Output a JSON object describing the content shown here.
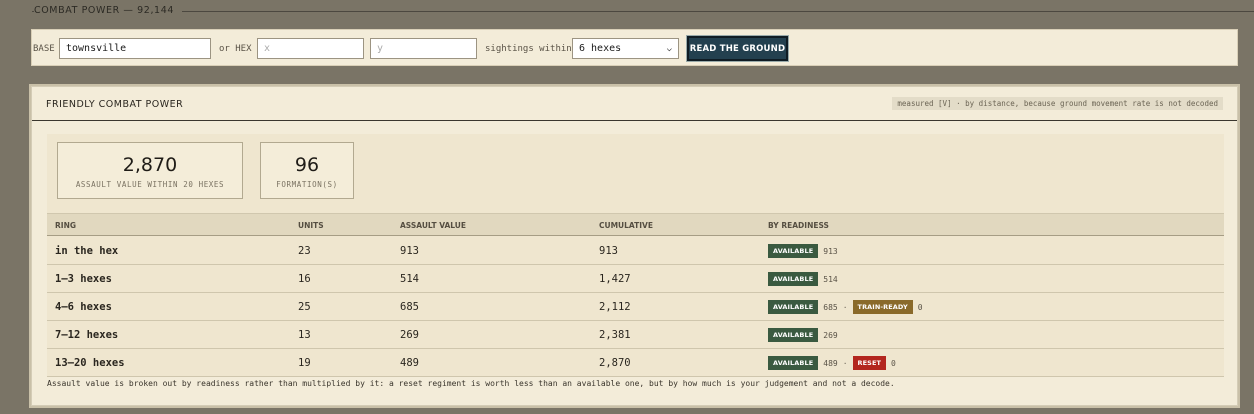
{
  "header": {
    "title": "COMBAT POWER — 92,144"
  },
  "search": {
    "base_label": "BASE",
    "base_value": "townsville",
    "or_hex_label": "or HEX",
    "x_placeholder": "x",
    "y_placeholder": "y",
    "sightings_label": "sightings within",
    "range_selected": "6 hexes",
    "submit_label": "READ THE GROUND"
  },
  "panel": {
    "title": "FRIENDLY COMBAT POWER",
    "note": "measured [V] · by distance, because ground movement rate is not decoded",
    "stats": [
      {
        "value": "2,870",
        "caption": "ASSAULT VALUE WITHIN 20 HEXES"
      },
      {
        "value": "96",
        "caption": "FORMATION(S)"
      }
    ],
    "table": {
      "headers": [
        "RING",
        "UNITS",
        "ASSAULT VALUE",
        "CUMULATIVE",
        "BY READINESS"
      ],
      "rows": [
        {
          "ring": "in the hex",
          "units": "23",
          "assault": "913",
          "cumulative": "913",
          "readiness": [
            {
              "label": "AVAILABLE",
              "kind": "available",
              "value": "913"
            }
          ]
        },
        {
          "ring": "1–3 hexes",
          "units": "16",
          "assault": "514",
          "cumulative": "1,427",
          "readiness": [
            {
              "label": "AVAILABLE",
              "kind": "available",
              "value": "514"
            }
          ]
        },
        {
          "ring": "4–6 hexes",
          "units": "25",
          "assault": "685",
          "cumulative": "2,112",
          "readiness": [
            {
              "label": "AVAILABLE",
              "kind": "available",
              "value": "685"
            },
            {
              "label": "TRAIN-READY",
              "kind": "train",
              "value": "0"
            }
          ]
        },
        {
          "ring": "7–12 hexes",
          "units": "13",
          "assault": "269",
          "cumulative": "2,381",
          "readiness": [
            {
              "label": "AVAILABLE",
              "kind": "available",
              "value": "269"
            }
          ]
        },
        {
          "ring": "13–20 hexes",
          "units": "19",
          "assault": "489",
          "cumulative": "2,870",
          "readiness": [
            {
              "label": "AVAILABLE",
              "kind": "available",
              "value": "489"
            },
            {
              "label": "RESET",
              "kind": "reset",
              "value": "0"
            }
          ]
        }
      ]
    },
    "footnote": "Assault value is broken out by readiness rather than multiplied by it: a reset regiment is worth less than an available one, but by how much is your judgement and not a decode."
  },
  "colors": {
    "background": "#7a7466",
    "panel": "#f3ecd9",
    "button": "#23404f",
    "available": "#3a5a40",
    "train_ready": "#8a6a2a",
    "reset": "#b3261e"
  },
  "icons": {
    "select_arrow": "chevron-down-icon"
  }
}
